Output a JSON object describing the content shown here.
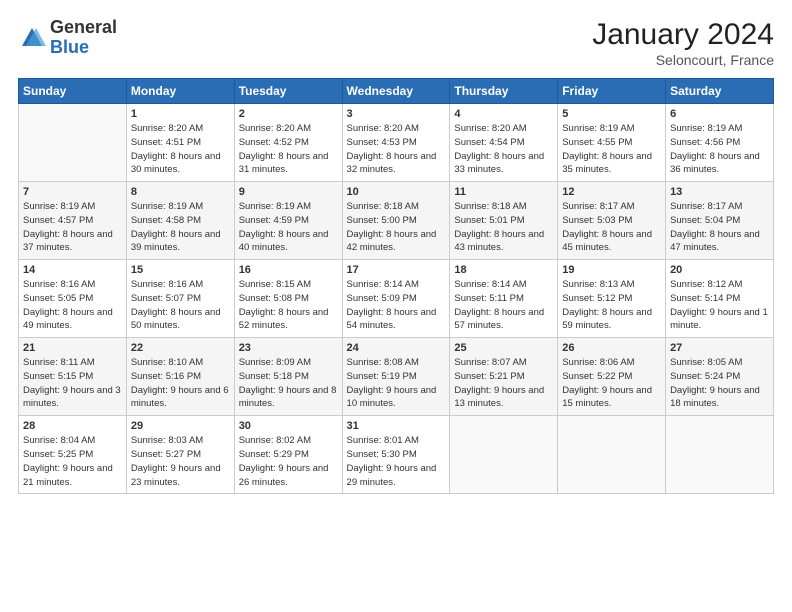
{
  "header": {
    "logo_general": "General",
    "logo_blue": "Blue",
    "title": "January 2024",
    "subtitle": "Seloncourt, France"
  },
  "days_header": [
    "Sunday",
    "Monday",
    "Tuesday",
    "Wednesday",
    "Thursday",
    "Friday",
    "Saturday"
  ],
  "weeks": [
    [
      {
        "day": "",
        "sunrise": "",
        "sunset": "",
        "daylight": ""
      },
      {
        "day": "1",
        "sunrise": "Sunrise: 8:20 AM",
        "sunset": "Sunset: 4:51 PM",
        "daylight": "Daylight: 8 hours and 30 minutes."
      },
      {
        "day": "2",
        "sunrise": "Sunrise: 8:20 AM",
        "sunset": "Sunset: 4:52 PM",
        "daylight": "Daylight: 8 hours and 31 minutes."
      },
      {
        "day": "3",
        "sunrise": "Sunrise: 8:20 AM",
        "sunset": "Sunset: 4:53 PM",
        "daylight": "Daylight: 8 hours and 32 minutes."
      },
      {
        "day": "4",
        "sunrise": "Sunrise: 8:20 AM",
        "sunset": "Sunset: 4:54 PM",
        "daylight": "Daylight: 8 hours and 33 minutes."
      },
      {
        "day": "5",
        "sunrise": "Sunrise: 8:19 AM",
        "sunset": "Sunset: 4:55 PM",
        "daylight": "Daylight: 8 hours and 35 minutes."
      },
      {
        "day": "6",
        "sunrise": "Sunrise: 8:19 AM",
        "sunset": "Sunset: 4:56 PM",
        "daylight": "Daylight: 8 hours and 36 minutes."
      }
    ],
    [
      {
        "day": "7",
        "sunrise": "Sunrise: 8:19 AM",
        "sunset": "Sunset: 4:57 PM",
        "daylight": "Daylight: 8 hours and 37 minutes."
      },
      {
        "day": "8",
        "sunrise": "Sunrise: 8:19 AM",
        "sunset": "Sunset: 4:58 PM",
        "daylight": "Daylight: 8 hours and 39 minutes."
      },
      {
        "day": "9",
        "sunrise": "Sunrise: 8:19 AM",
        "sunset": "Sunset: 4:59 PM",
        "daylight": "Daylight: 8 hours and 40 minutes."
      },
      {
        "day": "10",
        "sunrise": "Sunrise: 8:18 AM",
        "sunset": "Sunset: 5:00 PM",
        "daylight": "Daylight: 8 hours and 42 minutes."
      },
      {
        "day": "11",
        "sunrise": "Sunrise: 8:18 AM",
        "sunset": "Sunset: 5:01 PM",
        "daylight": "Daylight: 8 hours and 43 minutes."
      },
      {
        "day": "12",
        "sunrise": "Sunrise: 8:17 AM",
        "sunset": "Sunset: 5:03 PM",
        "daylight": "Daylight: 8 hours and 45 minutes."
      },
      {
        "day": "13",
        "sunrise": "Sunrise: 8:17 AM",
        "sunset": "Sunset: 5:04 PM",
        "daylight": "Daylight: 8 hours and 47 minutes."
      }
    ],
    [
      {
        "day": "14",
        "sunrise": "Sunrise: 8:16 AM",
        "sunset": "Sunset: 5:05 PM",
        "daylight": "Daylight: 8 hours and 49 minutes."
      },
      {
        "day": "15",
        "sunrise": "Sunrise: 8:16 AM",
        "sunset": "Sunset: 5:07 PM",
        "daylight": "Daylight: 8 hours and 50 minutes."
      },
      {
        "day": "16",
        "sunrise": "Sunrise: 8:15 AM",
        "sunset": "Sunset: 5:08 PM",
        "daylight": "Daylight: 8 hours and 52 minutes."
      },
      {
        "day": "17",
        "sunrise": "Sunrise: 8:14 AM",
        "sunset": "Sunset: 5:09 PM",
        "daylight": "Daylight: 8 hours and 54 minutes."
      },
      {
        "day": "18",
        "sunrise": "Sunrise: 8:14 AM",
        "sunset": "Sunset: 5:11 PM",
        "daylight": "Daylight: 8 hours and 57 minutes."
      },
      {
        "day": "19",
        "sunrise": "Sunrise: 8:13 AM",
        "sunset": "Sunset: 5:12 PM",
        "daylight": "Daylight: 8 hours and 59 minutes."
      },
      {
        "day": "20",
        "sunrise": "Sunrise: 8:12 AM",
        "sunset": "Sunset: 5:14 PM",
        "daylight": "Daylight: 9 hours and 1 minute."
      }
    ],
    [
      {
        "day": "21",
        "sunrise": "Sunrise: 8:11 AM",
        "sunset": "Sunset: 5:15 PM",
        "daylight": "Daylight: 9 hours and 3 minutes."
      },
      {
        "day": "22",
        "sunrise": "Sunrise: 8:10 AM",
        "sunset": "Sunset: 5:16 PM",
        "daylight": "Daylight: 9 hours and 6 minutes."
      },
      {
        "day": "23",
        "sunrise": "Sunrise: 8:09 AM",
        "sunset": "Sunset: 5:18 PM",
        "daylight": "Daylight: 9 hours and 8 minutes."
      },
      {
        "day": "24",
        "sunrise": "Sunrise: 8:08 AM",
        "sunset": "Sunset: 5:19 PM",
        "daylight": "Daylight: 9 hours and 10 minutes."
      },
      {
        "day": "25",
        "sunrise": "Sunrise: 8:07 AM",
        "sunset": "Sunset: 5:21 PM",
        "daylight": "Daylight: 9 hours and 13 minutes."
      },
      {
        "day": "26",
        "sunrise": "Sunrise: 8:06 AM",
        "sunset": "Sunset: 5:22 PM",
        "daylight": "Daylight: 9 hours and 15 minutes."
      },
      {
        "day": "27",
        "sunrise": "Sunrise: 8:05 AM",
        "sunset": "Sunset: 5:24 PM",
        "daylight": "Daylight: 9 hours and 18 minutes."
      }
    ],
    [
      {
        "day": "28",
        "sunrise": "Sunrise: 8:04 AM",
        "sunset": "Sunset: 5:25 PM",
        "daylight": "Daylight: 9 hours and 21 minutes."
      },
      {
        "day": "29",
        "sunrise": "Sunrise: 8:03 AM",
        "sunset": "Sunset: 5:27 PM",
        "daylight": "Daylight: 9 hours and 23 minutes."
      },
      {
        "day": "30",
        "sunrise": "Sunrise: 8:02 AM",
        "sunset": "Sunset: 5:29 PM",
        "daylight": "Daylight: 9 hours and 26 minutes."
      },
      {
        "day": "31",
        "sunrise": "Sunrise: 8:01 AM",
        "sunset": "Sunset: 5:30 PM",
        "daylight": "Daylight: 9 hours and 29 minutes."
      },
      {
        "day": "",
        "sunrise": "",
        "sunset": "",
        "daylight": ""
      },
      {
        "day": "",
        "sunrise": "",
        "sunset": "",
        "daylight": ""
      },
      {
        "day": "",
        "sunrise": "",
        "sunset": "",
        "daylight": ""
      }
    ]
  ]
}
